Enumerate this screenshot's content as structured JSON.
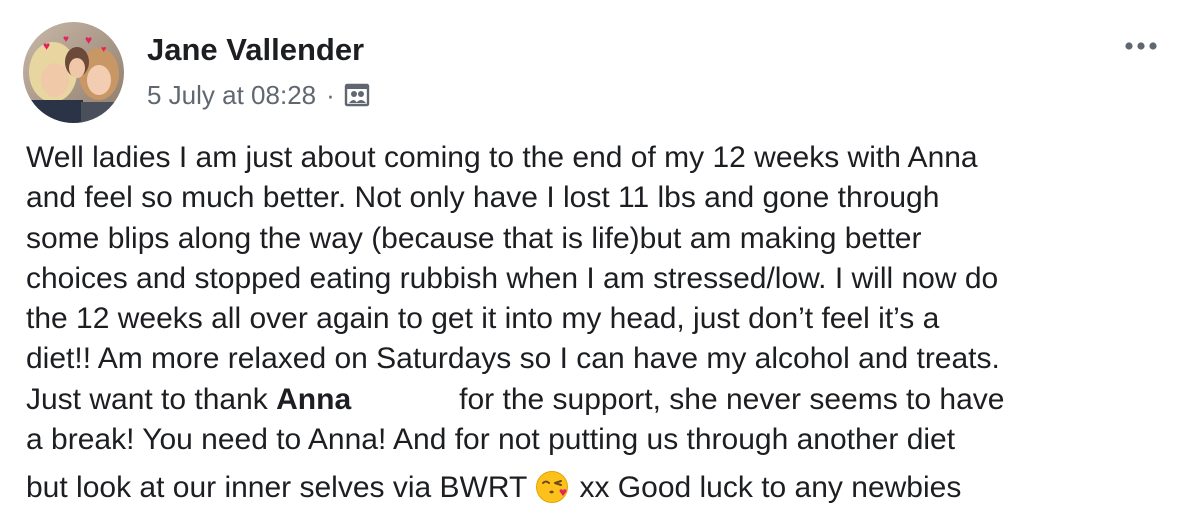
{
  "post": {
    "author": "Jane Vallender",
    "timestamp": "5 July at 08:28",
    "separator": "·",
    "audience_icon": "group-photo-icon",
    "more_icon": "more-options-icon",
    "body": {
      "line1": "Well ladies I am just about coming to the end of my 12 weeks with Anna",
      "line2": "and feel so much better. Not only have I lost 11 lbs and gone through",
      "line3": "some blips along the way (because that is life)but am making better",
      "line4": "choices and stopped eating rubbish when I am stressed/low. I will now do",
      "line5": "the 12 weeks all over again to get it into my head, just don’t feel it’s a",
      "line6": "diet!! Am more relaxed on Saturdays so I can have my alcohol and treats.",
      "line7_pre": "Just want to thank ",
      "line7_tag": "Anna",
      "line7_post": "for the support, she never seems to have",
      "line8": "a break! You need to Anna! And for not putting us through another diet",
      "line9_pre": "but look at our inner selves via BWRT ",
      "line9_emoji": "face-throwing-kiss-emoji",
      "line9_post": " xx Good luck to any newbies"
    }
  },
  "colors": {
    "text": "#1c1e21",
    "meta": "#606770",
    "icon": "#606770"
  }
}
